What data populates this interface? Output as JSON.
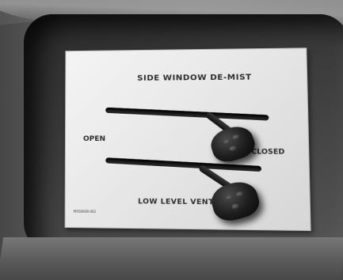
{
  "placard": {
    "title": "SIDE WINDOW DE-MIST",
    "open_label": "OPEN",
    "closed_label": "CLOSED",
    "low_level_label": "LOW LEVEL VENT",
    "part_number": "MXS0608-002"
  },
  "levers": [
    {
      "name": "side-window-demist-lever",
      "position": "closed"
    },
    {
      "name": "low-level-vent-lever",
      "position": "closed"
    }
  ],
  "colors": {
    "placard": "#ececec",
    "text": "#2e2e2e",
    "knob": "#1c1c1c",
    "panel": "#3c3c3c"
  }
}
